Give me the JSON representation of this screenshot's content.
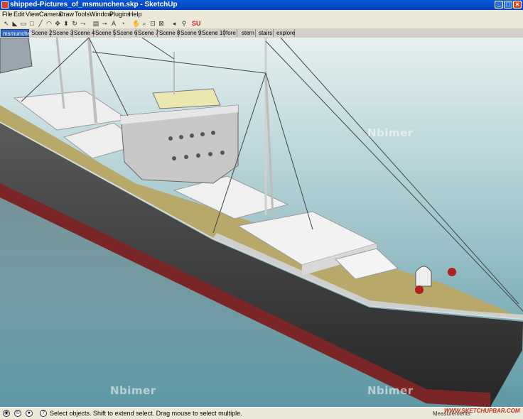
{
  "window": {
    "title": "shipped-Pictures_of_msmunchen.skp - SketchUp"
  },
  "menu": [
    "File",
    "Edit",
    "View",
    "Camera",
    "Draw",
    "Tools",
    "Window",
    "Plugins",
    "Help"
  ],
  "scenes": [
    "msmunchen",
    "Scene 2",
    "Scene 3",
    "Scene 4",
    "Scene 5",
    "Scene 6",
    "Scene 7",
    "Scene 8",
    "Scene 9",
    "Scene 10",
    "fore",
    "stern",
    "stairs",
    "explore"
  ],
  "active_scene": "msmunchen",
  "watermarks": [
    "Nbimer",
    "Nbimer",
    "Nbimer"
  ],
  "status": {
    "message": "Select objects. Shift to extend select. Drag mouse to select multiple.",
    "measurements_label": "Measurements",
    "site": "WWW.SKETCHUPBAR.COM"
  },
  "colors": {
    "titlebar": "#0a58d8",
    "sea": "#7fb3bd",
    "hull": "#3a3a3a",
    "boot_top": "#8a2a2a",
    "deck": "#b8a86a"
  }
}
